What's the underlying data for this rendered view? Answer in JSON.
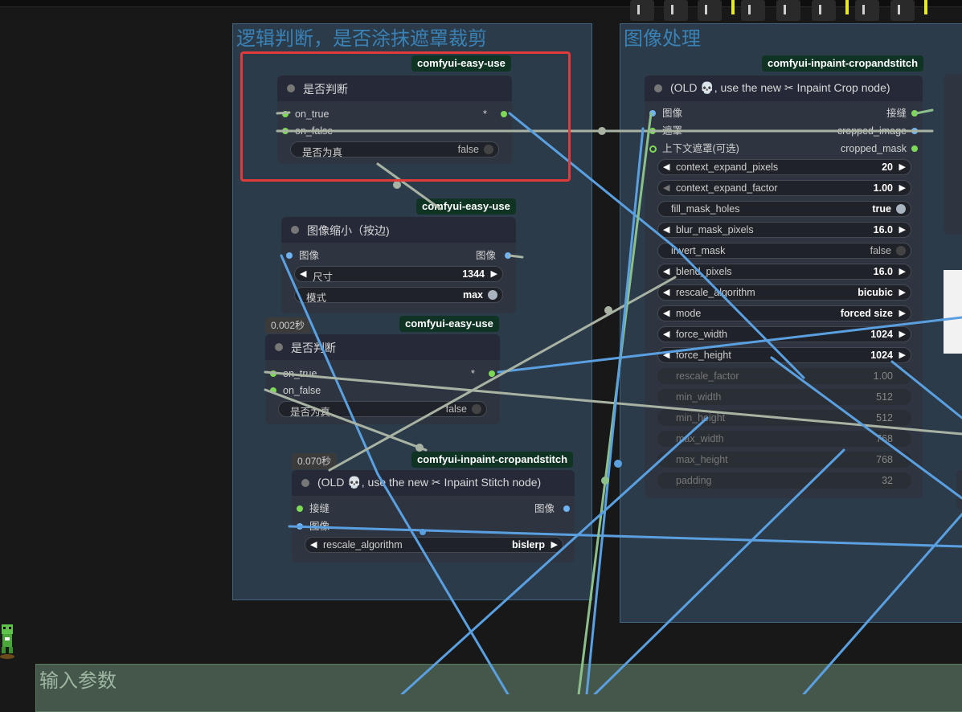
{
  "groups": {
    "logic": "逻辑判断，是否涂抹遮罩裁剪",
    "image": "图像处理",
    "input": "输入参数"
  },
  "nodes": {
    "if1": {
      "badge": "comfyui-easy-use",
      "title": "是否判断",
      "in_true": "on_true",
      "in_false": "on_false",
      "out_any": "*",
      "w_label": "是否为真",
      "w_value": "false"
    },
    "resize": {
      "badge": "comfyui-easy-use",
      "title": "图像缩小（按边)",
      "in_image": "图像",
      "out_image": "图像",
      "size_label": "尺寸",
      "size_value": "1344",
      "mode_label": "模式",
      "mode_value": "max"
    },
    "if2": {
      "time": "0.002秒",
      "badge": "comfyui-easy-use",
      "title": "是否判断",
      "in_true": "on_true",
      "in_false": "on_false",
      "out_any": "*",
      "w_label": "是否为真",
      "w_value": "false"
    },
    "stitch": {
      "time": "0.070秒",
      "badge": "comfyui-inpaint-cropandstitch",
      "title": "(OLD 💀, use the new ✂ Inpaint Stitch node)",
      "in_stitch": "接缝",
      "in_image": "图像",
      "out_image": "图像",
      "w_label": "rescale_algorithm",
      "w_value": "bislerp"
    },
    "crop": {
      "badge": "comfyui-inpaint-cropandstitch",
      "title": "(OLD 💀, use the new ✂ Inpaint Crop node)",
      "in_image": "图像",
      "in_mask": "遮罩",
      "in_ctx": "上下文遮罩(可选)",
      "out_stitch": "接缝",
      "out_cimage": "cropped_image",
      "out_cmask": "cropped_mask",
      "widgets": [
        {
          "label": "context_expand_pixels",
          "value": "20"
        },
        {
          "label": "context_expand_factor",
          "value": "1.00"
        },
        {
          "label": "fill_mask_holes",
          "value": "true"
        },
        {
          "label": "blur_mask_pixels",
          "value": "16.0"
        },
        {
          "label": "invert_mask",
          "value": "false"
        },
        {
          "label": "blend_pixels",
          "value": "16.0"
        },
        {
          "label": "rescale_algorithm",
          "value": "bicubic"
        },
        {
          "label": "mode",
          "value": "forced size"
        },
        {
          "label": "force_width",
          "value": "1024"
        },
        {
          "label": "force_height",
          "value": "1024"
        },
        {
          "label": "rescale_factor",
          "value": "1.00"
        },
        {
          "label": "min_width",
          "value": "512"
        },
        {
          "label": "min_height",
          "value": "512"
        },
        {
          "label": "max_width",
          "value": "768"
        },
        {
          "label": "max_height",
          "value": "768"
        },
        {
          "label": "padding",
          "value": "32"
        }
      ]
    }
  },
  "colors": {
    "accent_red": "#e03a3a",
    "wire_blue": "#5aa0e0",
    "wire_gray": "#a9b3a3",
    "wire_green": "#8cc08a",
    "badge_bg": "#0f3424"
  },
  "toolbar_icons": [
    "align-left-icon",
    "align-center-icon",
    "align-right-icon",
    "align-top-icon",
    "align-middle-icon",
    "align-bottom-icon",
    "distribute-h-icon",
    "distribute-v-icon"
  ]
}
